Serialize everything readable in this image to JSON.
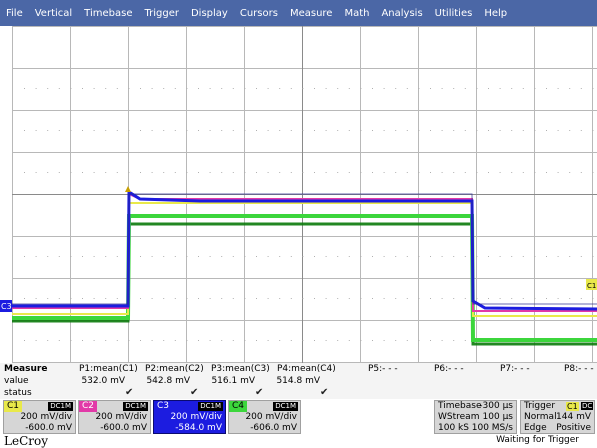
{
  "menu": [
    "File",
    "Vertical",
    "Timebase",
    "Trigger",
    "Display",
    "Cursors",
    "Measure",
    "Math",
    "Analysis",
    "Utilities",
    "Help"
  ],
  "colors": {
    "menubar": "#4b67a6",
    "c1": "#e9e94a",
    "c2": "#e23aa8",
    "c3": "#1c1ce0",
    "c4": "#3cd63c"
  },
  "markers": {
    "left": "C3",
    "right": "C1"
  },
  "measure": {
    "title": "Measure",
    "row_value": "value",
    "row_status": "status",
    "params": [
      {
        "name": "P1:mean(C1)",
        "value": "532.0 mV",
        "status": "✔"
      },
      {
        "name": "P2:mean(C2)",
        "value": "542.8 mV",
        "status": "✔"
      },
      {
        "name": "P3:mean(C3)",
        "value": "516.1 mV",
        "status": "✔"
      },
      {
        "name": "P4:mean(C4)",
        "value": "514.8 mV",
        "status": "✔"
      },
      {
        "name": "P5:- - -",
        "value": "",
        "status": ""
      },
      {
        "name": "P6:- - -",
        "value": "",
        "status": ""
      },
      {
        "name": "P7:- - -",
        "value": "",
        "status": ""
      },
      {
        "name": "P8:- - -",
        "value": "",
        "status": ""
      }
    ]
  },
  "channels": [
    {
      "tag": "C1",
      "coupling": "DC1M",
      "vdiv": "200 mV/div",
      "offset": "-600.0 mV"
    },
    {
      "tag": "C2",
      "coupling": "DC1M",
      "vdiv": "200 mV/div",
      "offset": "-600.0 mV"
    },
    {
      "tag": "C3",
      "coupling": "DC1M",
      "vdiv": "200 mV/div",
      "offset": "-584.0 mV"
    },
    {
      "tag": "C4",
      "coupling": "DC1M",
      "vdiv": "200 mV/div",
      "offset": "-606.0 mV"
    }
  ],
  "timebase": {
    "label": "Timebase",
    "delay": "-300 µs",
    "mode": "WStream",
    "tdiv": "100 µs",
    "samples": "100 kS",
    "rate": "100 MS/s"
  },
  "trigger": {
    "label": "Trigger",
    "source": "C1",
    "coupling": "DC",
    "mode": "Normal",
    "level": "144 mV",
    "type": "Edge",
    "slope": "Positive"
  },
  "footer": {
    "brand": "LeCroy",
    "status": "Waiting for Trigger"
  }
}
